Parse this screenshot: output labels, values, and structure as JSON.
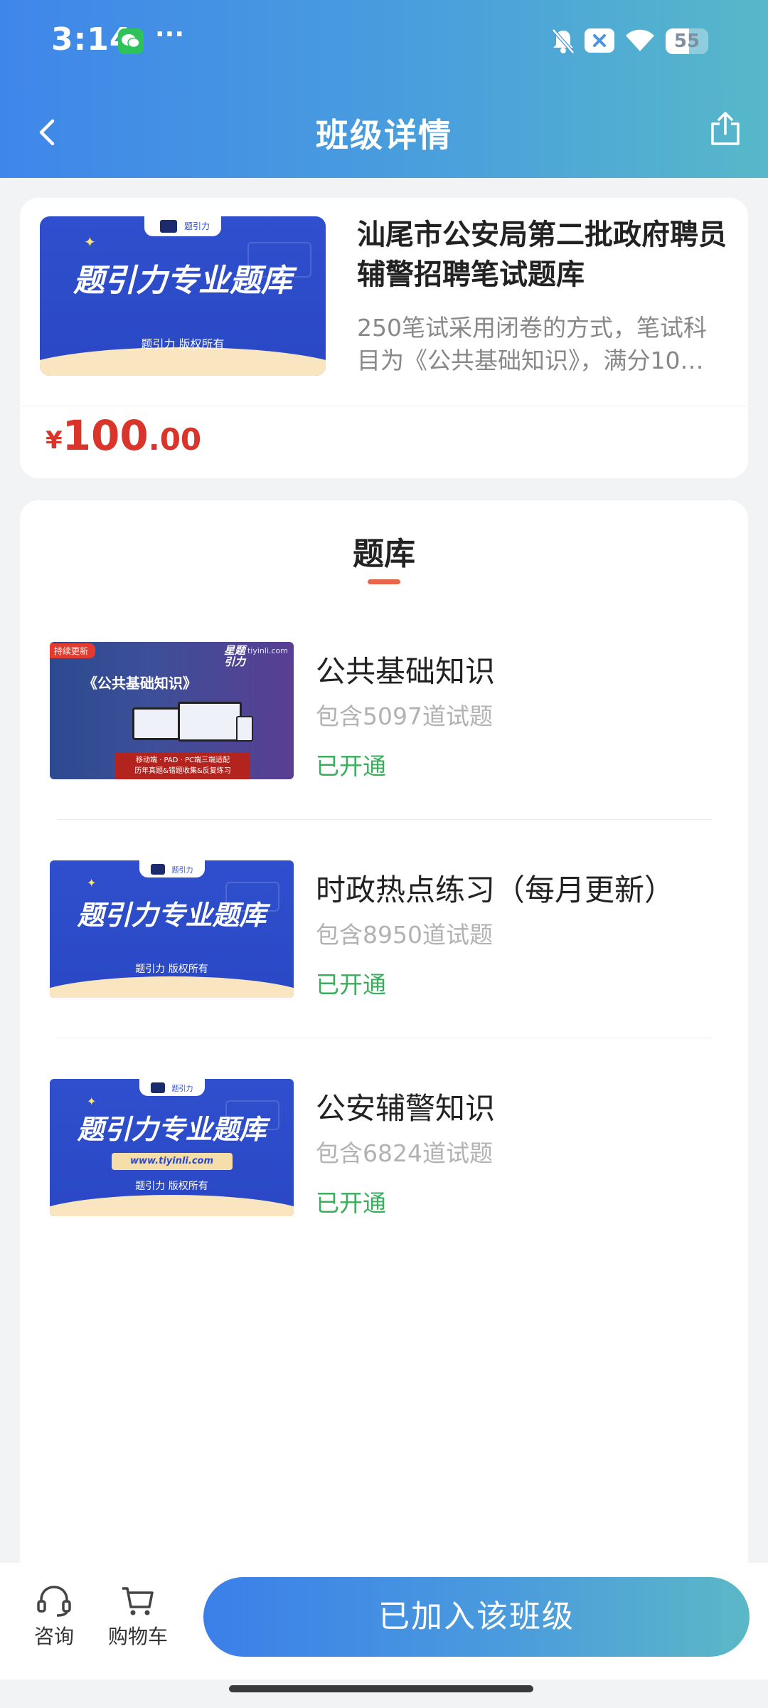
{
  "status_bar": {
    "time": "3:14",
    "more": "···",
    "battery": "55",
    "battery_level": 0.55
  },
  "nav": {
    "title": "班级详情"
  },
  "course": {
    "title": "汕尾市公安局第二批政府聘员辅警招聘笔试题库",
    "description": "250笔试采用闭卷的方式，笔试科目为《公共基础知识》，满分10…",
    "price_currency": "¥",
    "price_integer": "100",
    "price_decimal": ".00",
    "thumb": {
      "headline": "题引力专业题库",
      "copyright": "题引力 版权所有",
      "tab": "题引力"
    }
  },
  "section": {
    "title": "题库"
  },
  "banks": [
    {
      "name": "公共基础知识",
      "count": "包含5097道试题",
      "status": "已开通",
      "thumb": {
        "badge": "持续更新",
        "title": "《公共基础知识》",
        "site": "tiyinli.com",
        "logo": "星题引力",
        "banner_line1": "移动端 · PAD · PC端三端适配",
        "banner_line2": "历年真题&错题收集&反复练习"
      }
    },
    {
      "name": "时政热点练习（每月更新）",
      "count": "包含8950道试题",
      "status": "已开通",
      "thumb": {
        "headline": "题引力专业题库",
        "copyright": "题引力 版权所有",
        "tab": "题引力"
      }
    },
    {
      "name": "公安辅警知识",
      "count": "包含6824道试题",
      "status": "已开通",
      "thumb": {
        "headline": "题引力专业题库",
        "url": "www.tiyinli.com",
        "copyright": "题引力 版权所有",
        "tab": "题引力"
      }
    }
  ],
  "bottom_bar": {
    "consult": "咨询",
    "cart": "购物车",
    "join_label": "已加入该班级"
  },
  "colors": {
    "accent_blue": "#3f86ea",
    "price_red": "#d9352b",
    "status_green": "#3aae5c",
    "tab_underline": "#e8674b"
  }
}
